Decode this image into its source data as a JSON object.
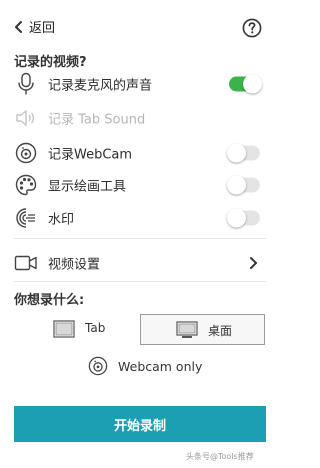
{
  "header": {
    "back_label": "返回",
    "help_icon": "question-circle-icon"
  },
  "record_section": {
    "title": "记录的视频?",
    "items": [
      {
        "label": "记录麦克风的声音",
        "icon": "microphone-icon",
        "toggle_on": true,
        "disabled": false
      },
      {
        "label": "记录 Tab Sound",
        "icon": "speaker-icon",
        "disabled": true
      },
      {
        "label": "记录WebCam",
        "icon": "webcam-icon",
        "toggle_on": false,
        "disabled": false
      },
      {
        "label": "显示绘画工具",
        "icon": "palette-icon",
        "toggle_on": false,
        "disabled": false
      },
      {
        "label": "水印",
        "icon": "watermark-icon",
        "toggle_on": false,
        "disabled": false
      }
    ]
  },
  "video_settings": {
    "label": "视频设置",
    "icon": "video-camera-icon"
  },
  "capture_section": {
    "title": "你想录什么:",
    "options": [
      {
        "label": "Tab",
        "icon": "tab-window-icon",
        "selected": false
      },
      {
        "label": "桌面",
        "icon": "monitor-icon",
        "selected": true
      }
    ],
    "webcam_only_label": "Webcam only"
  },
  "start_button_label": "开始录制",
  "watermark_text": "头条号@Tools推荐",
  "colors": {
    "accent": "#1ba0b3",
    "toggle_on": "#3cb24a",
    "toggle_off": "#e4e4e4"
  }
}
